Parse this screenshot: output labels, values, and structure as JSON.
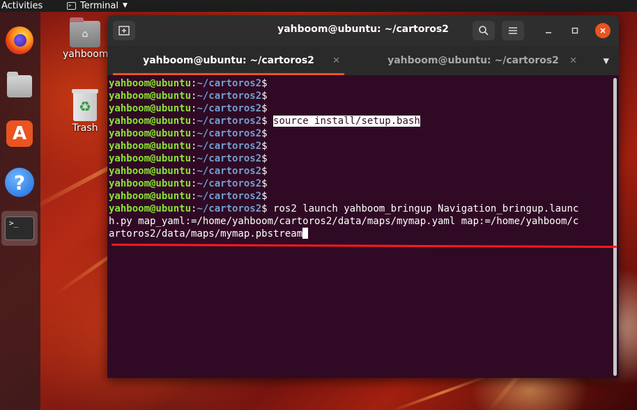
{
  "topbar": {
    "activities": "Activities",
    "app_name": "Terminal",
    "app_icon": "terminal-icon"
  },
  "dock": {
    "items": [
      {
        "name": "firefox",
        "icon": "firefox-icon"
      },
      {
        "name": "files",
        "icon": "files-icon"
      },
      {
        "name": "software",
        "icon": "software-store-icon"
      },
      {
        "name": "help",
        "icon": "help-icon"
      },
      {
        "name": "terminal",
        "icon": "terminal-icon",
        "active": true
      }
    ],
    "terminal_glyph": ">_"
  },
  "desktop": {
    "icons": [
      {
        "label": "yahboom",
        "icon": "home-folder-icon"
      },
      {
        "label": "Trash",
        "icon": "trash-icon"
      }
    ]
  },
  "window": {
    "title": "yahboom@ubuntu: ~/cartoros2",
    "tabs": [
      {
        "label": "yahboom@ubuntu: ~/cartoros2",
        "active": true
      },
      {
        "label": "yahboom@ubuntu: ~/cartoros2",
        "active": false
      }
    ]
  },
  "terminal": {
    "user_host": "yahboom@ubuntu",
    "colon": ":",
    "path": "~/cartoros2",
    "dollar": "$",
    "lines": [
      {
        "cmd": ""
      },
      {
        "cmd": ""
      },
      {
        "cmd": ""
      },
      {
        "cmd": "source install/setup.bash",
        "highlight": true
      },
      {
        "cmd": ""
      },
      {
        "cmd": ""
      },
      {
        "cmd": ""
      },
      {
        "cmd": ""
      },
      {
        "cmd": ""
      },
      {
        "cmd": ""
      },
      {
        "cmd": "ros2 launch yahboom_bringup Navigation_bringup.launc"
      }
    ],
    "continuation": [
      "h.py map_yaml:=/home/yahboom/cartoros2/data/maps/mymap.yaml map:=/home/yahboom/c",
      "artoros2/data/maps/mymap.pbstream"
    ]
  },
  "colors": {
    "terminal_bg": "#300a24",
    "prompt_user": "#8ae234",
    "prompt_path": "#729fcf",
    "accent": "#e95420",
    "annotation": "#ff1a1a"
  }
}
